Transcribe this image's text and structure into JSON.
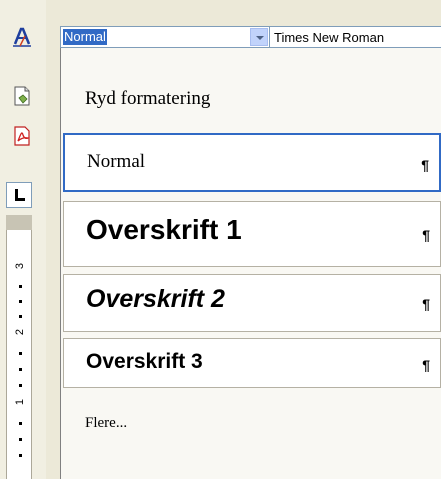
{
  "toolbar": {
    "style_value": "Normal",
    "font_value": "Times New Roman",
    "icons": [
      "styles-formatting-icon",
      "page-icon",
      "pdf-icon",
      "tab-selector-icon"
    ]
  },
  "ruler": {
    "numbers": [
      "3",
      "2",
      "1"
    ]
  },
  "styles_menu": {
    "clear_formatting": "Ryd formatering",
    "items": [
      {
        "label": "Normal",
        "mark": "¶"
      },
      {
        "label": "Overskrift 1",
        "mark": "¶"
      },
      {
        "label": "Overskrift 2",
        "mark": "¶"
      },
      {
        "label": "Overskrift 3",
        "mark": "¶"
      }
    ],
    "more": "Flere..."
  },
  "colors": {
    "selection": "#316ac5",
    "background": "#ece9d8",
    "menu_background": "#f9f8f3"
  }
}
